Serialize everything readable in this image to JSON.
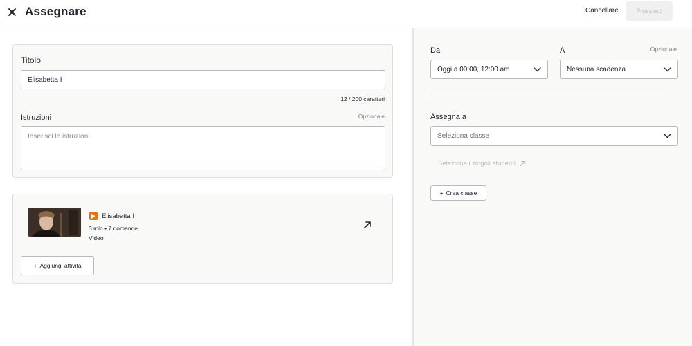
{
  "header": {
    "title": "Assegnare",
    "cancel_label": "Cancellare",
    "next_label": "Prossimo"
  },
  "assignment": {
    "title_label": "Titolo",
    "title_value": "Elisabetta I",
    "char_count": "12 / 200 caratteri",
    "instructions_label": "Istruzioni",
    "instructions_optional": "Opzionale",
    "instructions_placeholder": "Inserisci le istruzioni"
  },
  "activity": {
    "title": "Elisabetta I",
    "meta": "3 min • 7 domande",
    "type": "Video",
    "add_label": "Aggiungi attività",
    "icon_color": "#e8710a"
  },
  "schedule": {
    "from_label": "Da",
    "from_value": "Oggi a 00:00, 12:00 am",
    "to_label": "A",
    "to_optional": "Opzionale",
    "to_value": "Nessuna scadenza"
  },
  "assign_to": {
    "label": "Assegna a",
    "class_placeholder": "Seleziona classe",
    "select_students": "Seleziona i singoli studenti",
    "create_class": "Crea classe"
  }
}
